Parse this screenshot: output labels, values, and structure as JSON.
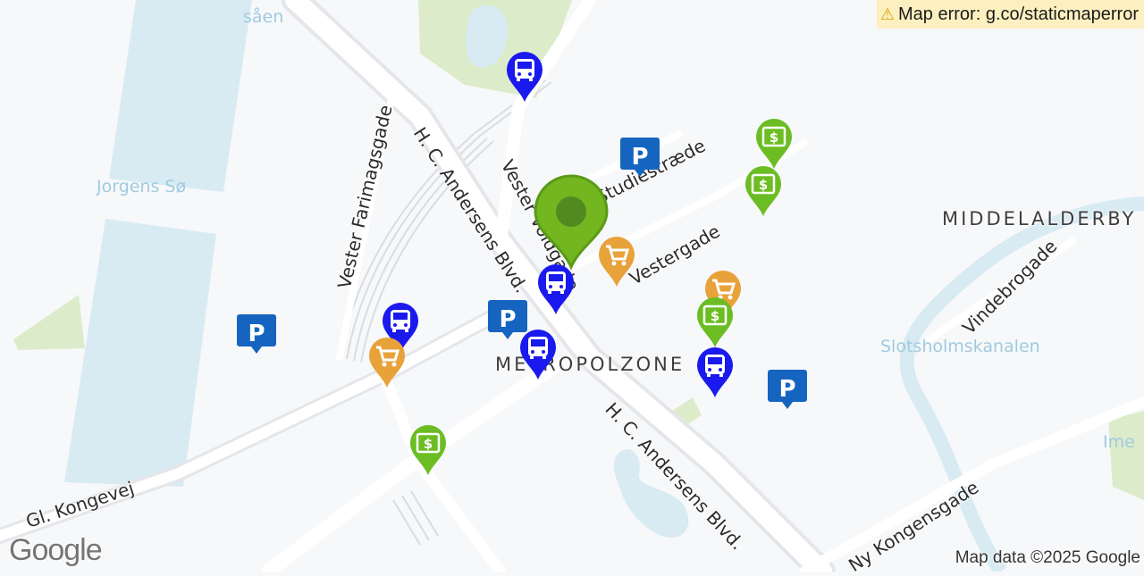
{
  "error": {
    "icon": "warning-icon",
    "text": "Map error: g.co/staticmaperror"
  },
  "attribution": "Map data ©2025 Google",
  "logo": "Google",
  "districts": {
    "middelalderby": "MIDDELALDERBY",
    "metropolzone": "METROPOLZONE"
  },
  "streets": {
    "hc_andersens_upper": "H. C. Andersens Blvd.",
    "hc_andersens_lower": "H. C. Andersens Blvd.",
    "vester_farimagsgade": "Vester Farimagsgade",
    "vester_voldgade": "Vester Voldgade",
    "studiestraede": "Studiestræde",
    "vestergade": "Vestergade",
    "gl_kongevej": "Gl. Kongevej",
    "vindebrogade": "Vindebrogade",
    "ny_kongensgade": "Ny Kongensgade"
  },
  "water": {
    "jorgens_so": "Jorgens Sø",
    "sortedams": "såen",
    "slotsholmskanalen": "Slotsholmskanalen",
    "holmen": "Ime"
  },
  "colors": {
    "bus": "#1a1aee",
    "parking": "#1565c0",
    "shopping": "#e8a23a",
    "money": "#6cbd23",
    "center": "#73b620",
    "water": "#d8ebf3",
    "park": "#dceccb",
    "road": "#ffffff"
  },
  "markers": [
    {
      "type": "center",
      "icon": "location-pin-icon"
    },
    {
      "type": "bus",
      "icon": "bus-icon"
    },
    {
      "type": "bus",
      "icon": "bus-icon"
    },
    {
      "type": "bus",
      "icon": "bus-icon"
    },
    {
      "type": "bus",
      "icon": "bus-icon"
    },
    {
      "type": "bus",
      "icon": "bus-icon"
    },
    {
      "type": "parking",
      "icon": "parking-icon"
    },
    {
      "type": "parking",
      "icon": "parking-icon"
    },
    {
      "type": "parking",
      "icon": "parking-icon"
    },
    {
      "type": "parking",
      "icon": "parking-icon"
    },
    {
      "type": "shopping",
      "icon": "shopping-cart-icon"
    },
    {
      "type": "shopping",
      "icon": "shopping-cart-icon"
    },
    {
      "type": "shopping",
      "icon": "shopping-cart-icon"
    },
    {
      "type": "money",
      "icon": "money-icon"
    },
    {
      "type": "money",
      "icon": "money-icon"
    },
    {
      "type": "money",
      "icon": "money-icon"
    },
    {
      "type": "money",
      "icon": "money-icon"
    }
  ]
}
